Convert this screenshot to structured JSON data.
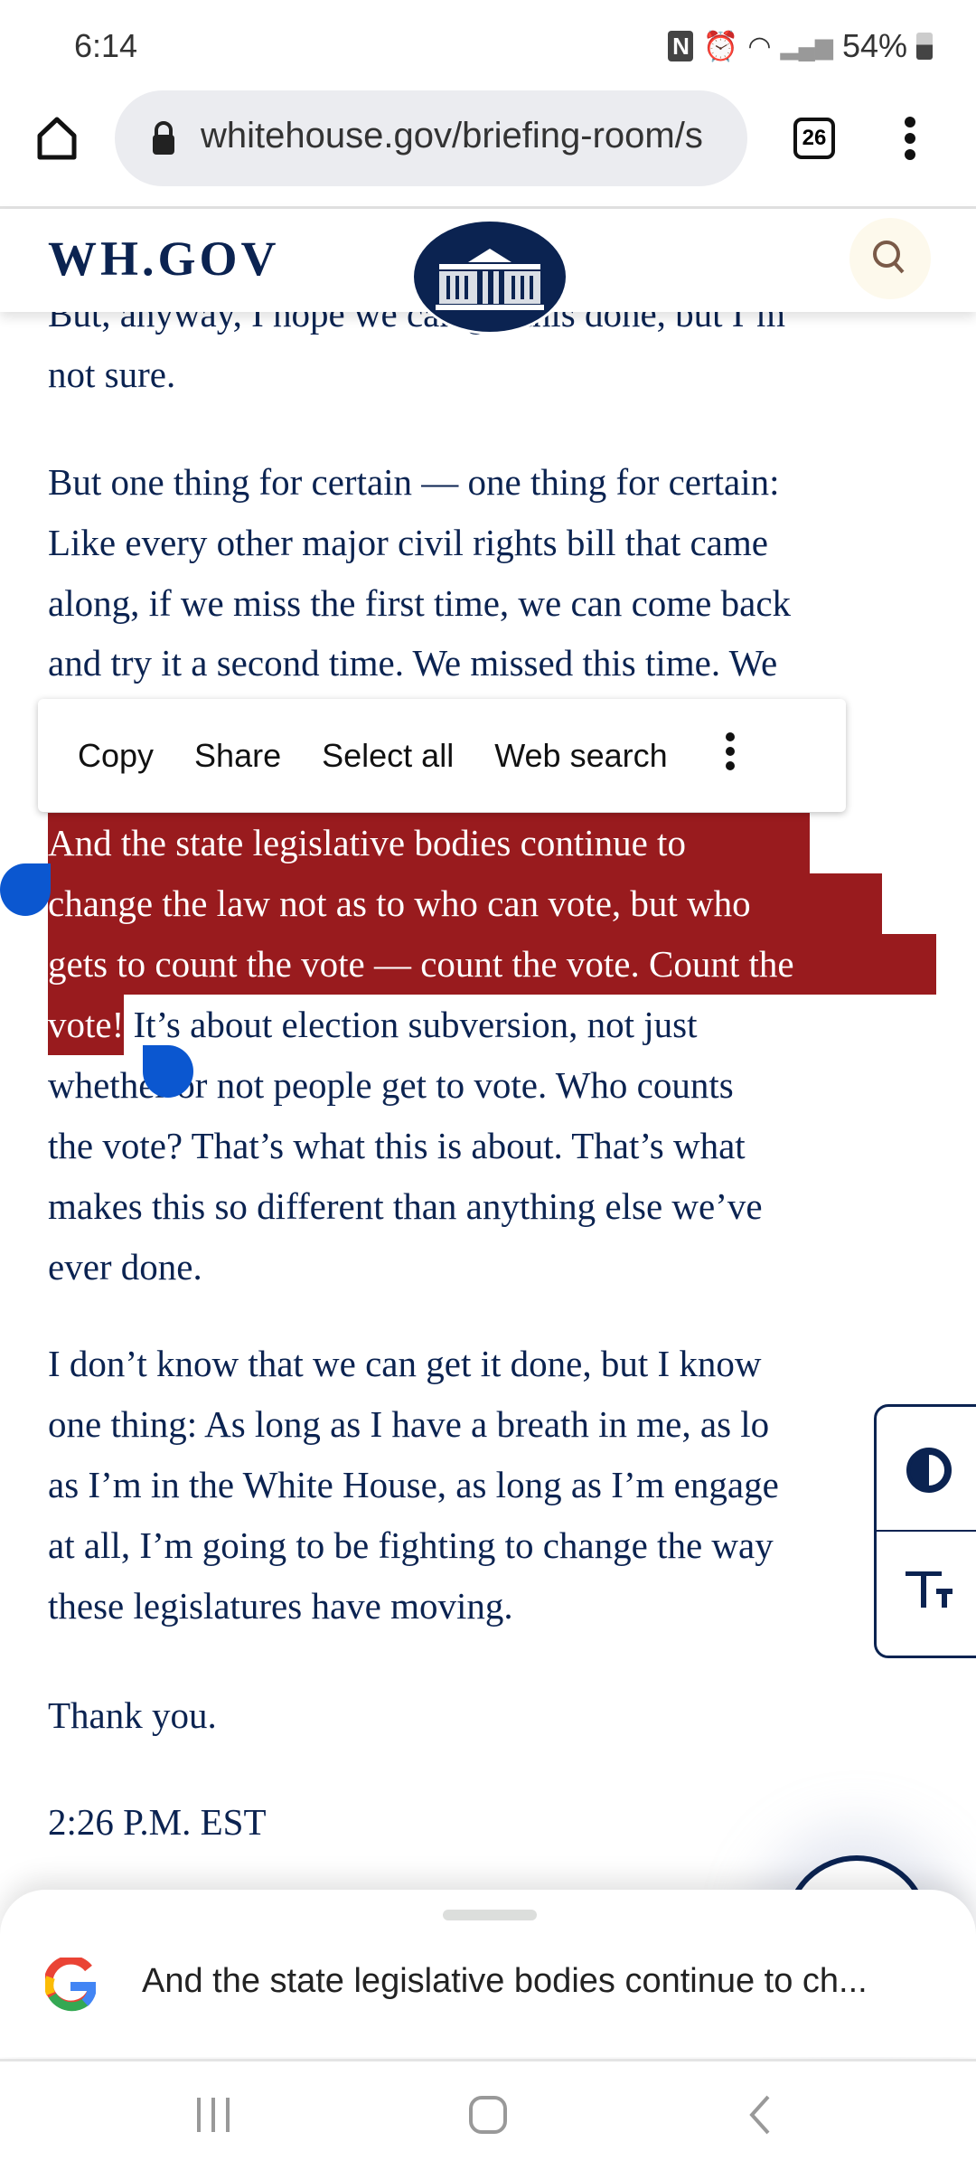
{
  "status_bar": {
    "time": "6:14",
    "battery": "54%",
    "icons": [
      "nfc-icon",
      "alarm-icon",
      "wifi-icon",
      "signal-icon",
      "battery-icon"
    ]
  },
  "browser": {
    "url": "whitehouse.gov/briefing-room/s",
    "tab_count": "26"
  },
  "site_header": {
    "logo": "WH.GOV"
  },
  "article": {
    "lines_top": [
      "But, anyway, I hope we can get this done, but I’m",
      "not sure."
    ],
    "para1": [
      "But one thing for certain — one thing for certain:",
      "Like every other major civil rights bill that came",
      "along, if we miss the first time, we can come back",
      "and try it a second time.  We missed this time.  We"
    ],
    "selected": [
      "And the state legislative bodies continue to",
      "change the law not as to who can vote, but who",
      "gets to count the vote — count the vote.  Count the",
      "vote!"
    ],
    "after_selection": " It’s about election subversion, not just",
    "para2_rest": [
      "whether or not people get to vote.  Who counts",
      "the vote?  That’s what this is about.  That’s what",
      "makes this so different than anything else we’ve",
      "ever done."
    ],
    "para3": [
      "I don’t know that we can get it done, but I know",
      "one thing: As long as I have a breath in me, as lo",
      "as I’m in the White House, as long as I’m engage",
      "at all, I’m going to be fighting to change the way",
      "these legislatures have moving."
    ],
    "thanks": "Thank you.",
    "end_time": "2:26 P.M. EST"
  },
  "selection_menu": {
    "items": [
      "Copy",
      "Share",
      "Select all",
      "Web search"
    ]
  },
  "google_sheet": {
    "query": "And the state legislative bodies continue to ch..."
  },
  "colors": {
    "navy": "#0b2351",
    "selection": "#991b1e",
    "handle": "#0b57d0"
  }
}
